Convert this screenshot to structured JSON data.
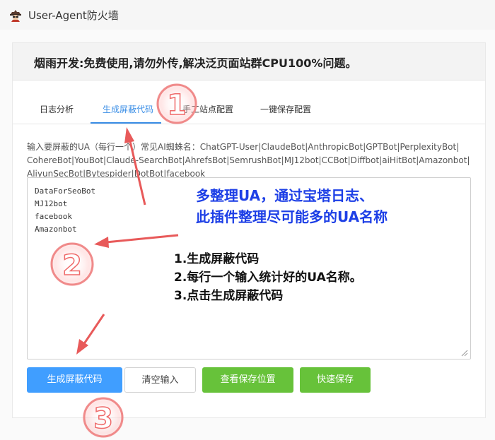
{
  "window": {
    "title": "User-Agent防火墙",
    "icon": "spy-icon"
  },
  "notice": "烟雨开发:免费使用,请勿外传,解决泛页面站群CPU100%问题。",
  "tabs": [
    {
      "label": "日志分析",
      "active": false
    },
    {
      "label": "生成屏蔽代码",
      "active": true
    },
    {
      "label": "手工站点配置",
      "active": false
    },
    {
      "label": "一键保存配置",
      "active": false
    }
  ],
  "hint_lines": [
    "输入要屏蔽的UA（每行一个）常见AI蜘蛛名：ChatGPT-User|ClaudeBot|AnthropicBot|GPTBot|PerplexityBot|",
    "CohereBot|YouBot|Claude-SearchBot|AhrefsBot|SemrushBot|MJ12bot|CCBot|Diffbot|aiHitBot|Amazonbot|",
    "AliyunSecBot|Bytespider|DotBot|facebook"
  ],
  "ua_input": [
    "DataForSeoBot",
    "MJ12bot",
    "facebook",
    "Amazonbot"
  ],
  "buttons": {
    "generate": "生成屏蔽代码",
    "clear": "清空输入",
    "view_location": "查看保存位置",
    "quick_save": "快速保存"
  },
  "annotations": {
    "blue_line1": "多整理UA，通过宝塔日志、",
    "blue_line2": "此插件整理尽可能多的UA名称",
    "steps": [
      "1.生成屏蔽代码",
      "2.每行一个输入统计好的UA名称。",
      "3.点击生成屏蔽代码"
    ],
    "circle_numbers": [
      "1",
      "2",
      "3"
    ]
  },
  "colors": {
    "accent": "#409eff",
    "success": "#67c23a",
    "annotation_red": "#e85a5a",
    "annotation_blue": "#1d3fe6"
  }
}
